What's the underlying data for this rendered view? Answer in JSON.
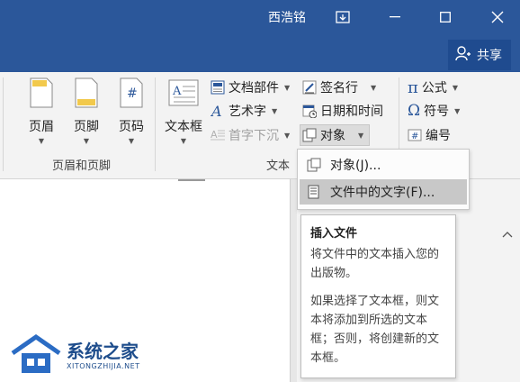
{
  "titlebar": {
    "user_name": "西浩铭",
    "share_label": "共享"
  },
  "ribbon": {
    "header_footer_group": {
      "label": "页眉和页脚",
      "header": "页眉",
      "footer": "页脚",
      "page_number": "页码"
    },
    "text_group": {
      "label": "文本",
      "text_box": "文本框",
      "quick_parts": "文档部件",
      "wordart": "艺术字",
      "drop_cap": "首字下沉",
      "signature_line": "签名行",
      "date_time": "日期和时间",
      "object": "对象"
    },
    "symbols_group": {
      "equation": "公式",
      "symbol": "符号",
      "number": "编号"
    }
  },
  "object_menu": {
    "items": [
      {
        "label": "对象(J)..."
      },
      {
        "label": "文件中的文字(F)..."
      }
    ]
  },
  "tooltip": {
    "title": "插入文件",
    "desc1": "将文件中的文本插入您的出版物。",
    "desc2": "如果选择了文本框，则文本将添加到所选的文本框；否则，将创建新的文本框。"
  },
  "watermark": {
    "text": "系统之家",
    "sub": "XITONGZHIJIA.NET"
  },
  "colors": {
    "titlebar": "#2b579a",
    "share": "#1f4b8f",
    "highlight": "#c8c8c8"
  }
}
